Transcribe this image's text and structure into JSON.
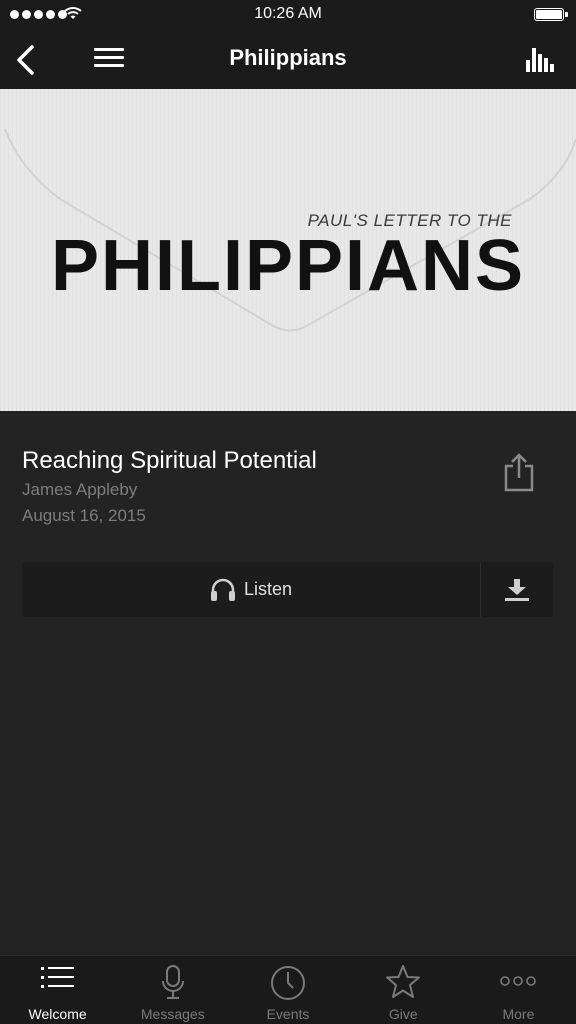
{
  "status_bar": {
    "time": "10:26 AM"
  },
  "nav": {
    "title": "Philippians"
  },
  "banner": {
    "subtitle": "PAUL'S LETTER TO THE",
    "title": "PHILIPPIANS"
  },
  "sermon": {
    "title": "Reaching Spiritual Potential",
    "speaker": "James Appleby",
    "date": "August 16, 2015"
  },
  "actions": {
    "listen_label": "Listen"
  },
  "tabs": [
    {
      "label": "Welcome",
      "icon": "list-icon",
      "active": true
    },
    {
      "label": "Messages",
      "icon": "microphone-icon",
      "active": false
    },
    {
      "label": "Events",
      "icon": "clock-icon",
      "active": false
    },
    {
      "label": "Give",
      "icon": "star-icon",
      "active": false
    },
    {
      "label": "More",
      "icon": "more-icon",
      "active": false
    }
  ],
  "colors": {
    "background": "#232323",
    "bar": "#1b1b1b",
    "muted_text": "#7d7d7d"
  }
}
